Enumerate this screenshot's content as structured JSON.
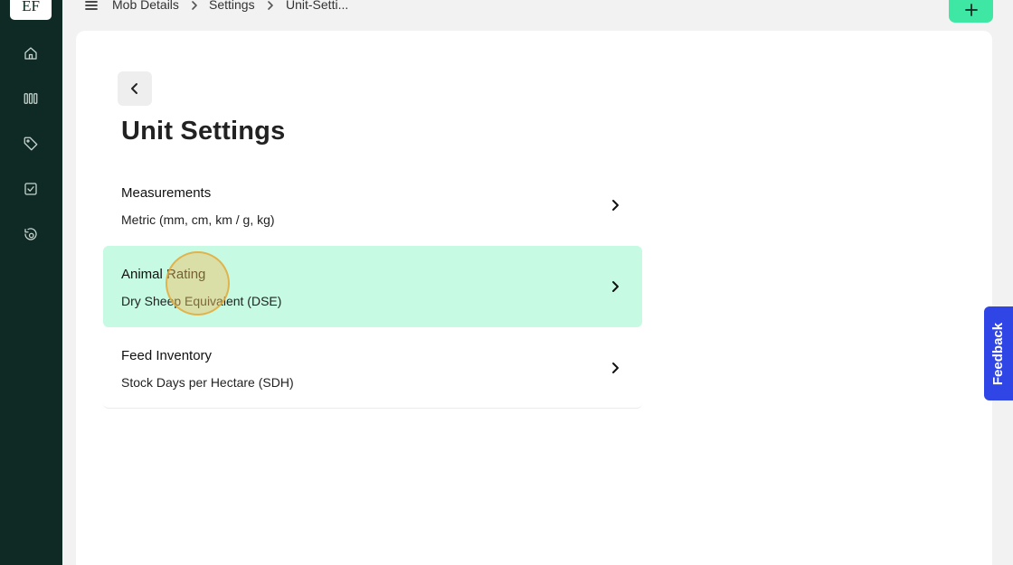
{
  "sidebar": {
    "logo_text": "EF",
    "items": [
      {
        "name": "home-icon"
      },
      {
        "name": "paddocks-icon"
      },
      {
        "name": "tag-icon"
      },
      {
        "name": "tasks-icon"
      },
      {
        "name": "recent-icon"
      }
    ]
  },
  "topbar": {
    "menu_icon": "hamburger-menu-icon",
    "breadcrumbs": [
      "Mob Details",
      "Settings",
      "Unit-Setti..."
    ],
    "add_button_icon": "plus-icon"
  },
  "page": {
    "title": "Unit Settings",
    "back_icon": "chevron-left-icon"
  },
  "settings": [
    {
      "title": "Measurements",
      "value": "Metric (mm, cm, km / g, kg)"
    },
    {
      "title": "Animal Rating",
      "value": "Dry Sheep Equivalent (DSE)"
    },
    {
      "title": "Feed Inventory",
      "value": "Stock Days per Hectare (SDH)"
    }
  ],
  "feedback": {
    "label": "Feedback"
  },
  "colors": {
    "sidebar_bg": "#0f2a24",
    "accent_green": "#3ee8a4",
    "row_highlight": "#c6fae3",
    "feedback_blue": "#2f45e6"
  }
}
